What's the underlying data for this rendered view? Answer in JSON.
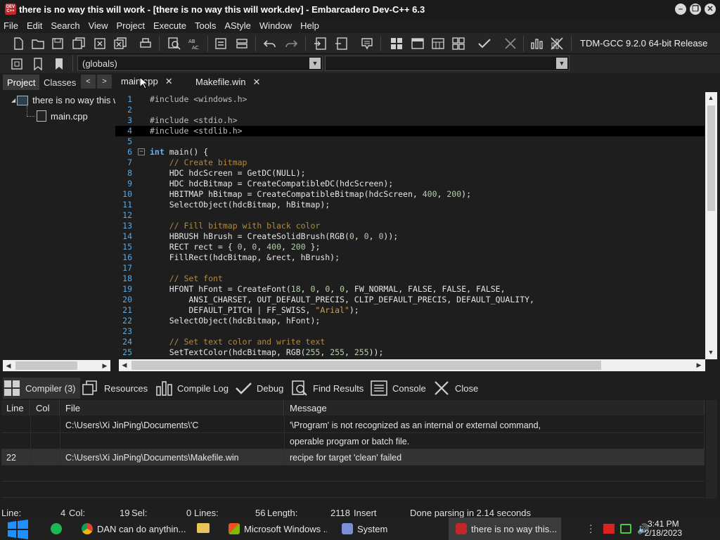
{
  "window": {
    "icon_text": "DEV C++",
    "title": "there is no way this will work - [there is no way this will work.dev] - Embarcadero Dev-C++ 6.3",
    "buttons": [
      "–",
      "❐",
      "✕"
    ]
  },
  "menu": [
    "File",
    "Edit",
    "Search",
    "View",
    "Project",
    "Execute",
    "Tools",
    "AStyle",
    "Window",
    "Help"
  ],
  "toolbar": {
    "compiler": "TDM-GCC 9.2.0 64-bit Release",
    "scope": "(globals)"
  },
  "left_panel": {
    "tabs": [
      "Project",
      "Classes"
    ],
    "nav": [
      "<",
      ">"
    ],
    "tree": {
      "project": "there is no way this will work",
      "file": "main.cpp"
    }
  },
  "editor": {
    "tabs": [
      {
        "label": "main.cpp",
        "close": "✕"
      },
      {
        "label": "Makefile.win",
        "close": "✕"
      }
    ],
    "current_line": 4,
    "lines": [
      {
        "n": "1",
        "code": "#include <windows.h>"
      },
      {
        "n": "2",
        "code": ""
      },
      {
        "n": "3",
        "code": "#include <stdio.h>"
      },
      {
        "n": "4",
        "code": "#include <stdlib.h>"
      },
      {
        "n": "5",
        "code": ""
      },
      {
        "n": "6",
        "code": "int main() {"
      },
      {
        "n": "7",
        "code": "    // Create bitmap"
      },
      {
        "n": "8",
        "code": "    HDC hdcScreen = GetDC(NULL);"
      },
      {
        "n": "9",
        "code": "    HDC hdcBitmap = CreateCompatibleDC(hdcScreen);"
      },
      {
        "n": "10",
        "code": "    HBITMAP hBitmap = CreateCompatibleBitmap(hdcScreen, 400, 200);"
      },
      {
        "n": "11",
        "code": "    SelectObject(hdcBitmap, hBitmap);"
      },
      {
        "n": "12",
        "code": ""
      },
      {
        "n": "13",
        "code": "    // Fill bitmap with black color"
      },
      {
        "n": "14",
        "code": "    HBRUSH hBrush = CreateSolidBrush(RGB(0, 0, 0));"
      },
      {
        "n": "15",
        "code": "    RECT rect = { 0, 0, 400, 200 };"
      },
      {
        "n": "16",
        "code": "    FillRect(hdcBitmap, &rect, hBrush);"
      },
      {
        "n": "17",
        "code": ""
      },
      {
        "n": "18",
        "code": "    // Set font"
      },
      {
        "n": "19",
        "code": "    HFONT hFont = CreateFont(18, 0, 0, 0, FW_NORMAL, FALSE, FALSE, FALSE,"
      },
      {
        "n": "20",
        "code": "        ANSI_CHARSET, OUT_DEFAULT_PRECIS, CLIP_DEFAULT_PRECIS, DEFAULT_QUALITY,"
      },
      {
        "n": "21",
        "code": "        DEFAULT_PITCH | FF_SWISS, \"Arial\");"
      },
      {
        "n": "22",
        "code": "    SelectObject(hdcBitmap, hFont);"
      },
      {
        "n": "23",
        "code": ""
      },
      {
        "n": "24",
        "code": "    // Set text color and write text"
      },
      {
        "n": "25",
        "code": "    SetTextColor(hdcBitmap, RGB(255, 255, 255));"
      }
    ]
  },
  "bottom_tabs": [
    "Compiler (3)",
    "Resources",
    "Compile Log",
    "Debug",
    "Find Results",
    "Console",
    "Close"
  ],
  "messages": {
    "columns": [
      "Line",
      "Col",
      "File",
      "Message"
    ],
    "rows": [
      {
        "line": "",
        "col": "",
        "file": "C:\\Users\\Xi JinPing\\Documents\\'C",
        "message": "'\\Program' is not recognized as an internal or external command,"
      },
      {
        "line": "",
        "col": "",
        "file": "",
        "message": "operable program or batch file."
      },
      {
        "line": "22",
        "col": "",
        "file": "C:\\Users\\Xi JinPing\\Documents\\Makefile.win",
        "message": "recipe for target 'clean' failed"
      }
    ]
  },
  "status": {
    "line_label": "Line:",
    "line_value": "4",
    "col_label": "Col:",
    "col_value": "19",
    "sel_label": "Sel:",
    "sel_value": "0",
    "lines_label": "Lines:",
    "lines_value": "56",
    "length_label": "Length:",
    "length_value": "2118",
    "mode": "Insert",
    "parse": "Done parsing in 2.14 seconds"
  },
  "taskbar": {
    "items": [
      "DAN can do anythin...",
      "Microsoft Windows ...",
      "System",
      "there is no way this..."
    ],
    "time": "3:41 PM",
    "date": "2/18/2023"
  },
  "colors": {
    "keyword": "#6ab0f3",
    "comment": "#b08a3e",
    "line_number": "#5da8e0",
    "app_icon": "#c0282d"
  }
}
